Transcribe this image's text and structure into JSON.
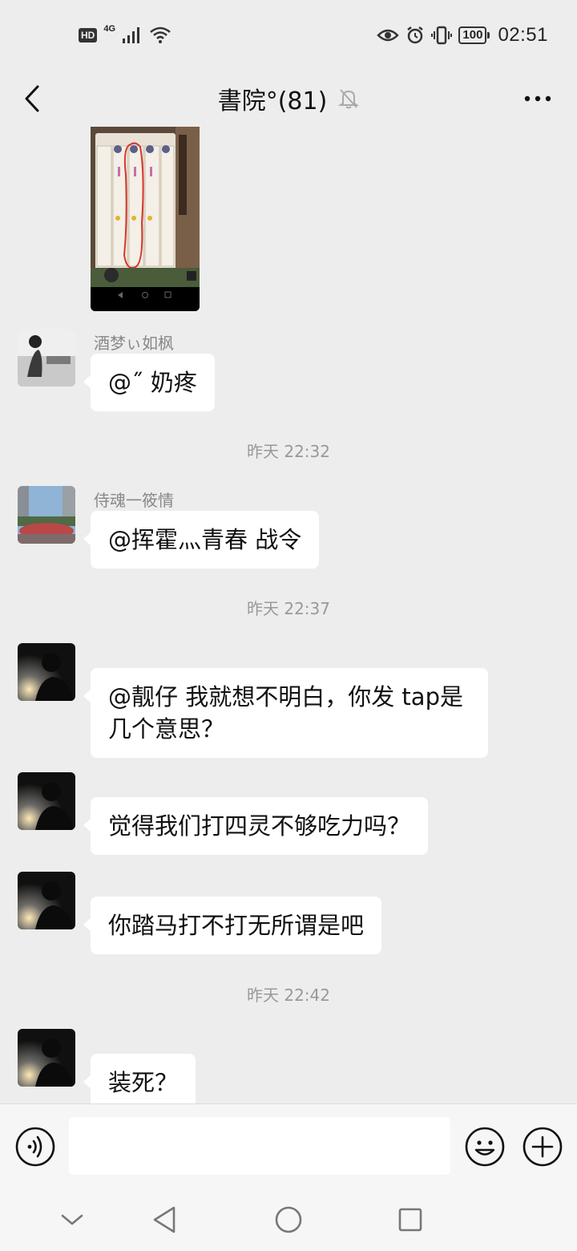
{
  "status_bar": {
    "hd": "HD",
    "network": "4G",
    "battery": "100",
    "time": "02:51"
  },
  "header": {
    "title": "書院°(81)",
    "muted_icon": "bell-off-icon",
    "back_icon": "chevron-left-icon",
    "more_icon": "more-dots-icon"
  },
  "messages": [
    {
      "type": "image"
    },
    {
      "type": "text",
      "sender": "酒梦ぃ如枫",
      "text": "@˝  奶疼"
    },
    {
      "type": "time",
      "text": "昨天 22:32"
    },
    {
      "type": "text",
      "sender": "侍魂一筱情",
      "text": "@挥霍灬青春  战令"
    },
    {
      "type": "time",
      "text": "昨天 22:37"
    },
    {
      "type": "text",
      "sender": "",
      "text": "@靓仔  我就想不明白，你发 tap是几个意思？"
    },
    {
      "type": "text",
      "sender": "",
      "text": "觉得我们打四灵不够吃力吗？"
    },
    {
      "type": "text",
      "sender": "",
      "text": "你踏马打不打无所谓是吧"
    },
    {
      "type": "time",
      "text": "昨天 22:42"
    },
    {
      "type": "text",
      "sender": "",
      "text": "装死？"
    }
  ],
  "input": {
    "value": "",
    "voice_icon": "voice-icon",
    "emoji_icon": "emoji-icon",
    "plus_icon": "plus-icon"
  },
  "system_nav": [
    "chevron-down-icon",
    "back-triangle-icon",
    "home-circle-icon",
    "recents-square-icon"
  ],
  "colors": {
    "background": "#ededed",
    "bubble": "#ffffff",
    "timestamp": "#999999",
    "sender": "#888888"
  }
}
